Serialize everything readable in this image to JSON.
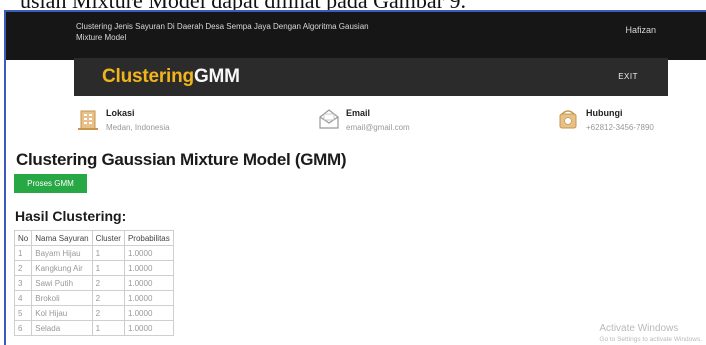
{
  "document": {
    "caption_fragment": "usian Mixture Model dapat dilihat pada Gambar 9."
  },
  "topbar": {
    "site_title": "Clustering Jenis Sayuran Di Daerah Desa Sempa Jaya Dengan Algoritma Gausian Mixture Model",
    "username": "Hafizan"
  },
  "navbar": {
    "brand_part1": "Clustering",
    "brand_part2": "GMM",
    "exit_label": "EXIT"
  },
  "info": {
    "lokasi": {
      "label": "Lokasi",
      "value": "Medan, Indonesia",
      "icon": "building-icon"
    },
    "email": {
      "label": "Email",
      "value": "email@gmail.com",
      "icon": "envelope-icon"
    },
    "hubungi": {
      "label": "Hubungi",
      "value": "+62812-3456-7890",
      "icon": "phone-icon"
    }
  },
  "main": {
    "title": "Clustering Gaussian Mixture Model (GMM)",
    "proses_button": "Proses GMM",
    "hasil_title": "Hasil Clustering:"
  },
  "table": {
    "headers": [
      "No",
      "Nama Sayuran",
      "Cluster",
      "Probabilitas"
    ],
    "rows": [
      [
        "1",
        "Bayam Hijau",
        "1",
        "1.0000"
      ],
      [
        "2",
        "Kangkung Air",
        "1",
        "1.0000"
      ],
      [
        "3",
        "Sawi Putih",
        "2",
        "1.0000"
      ],
      [
        "4",
        "Brokoli",
        "2",
        "1.0000"
      ],
      [
        "5",
        "Kol Hijau",
        "2",
        "1.0000"
      ],
      [
        "6",
        "Selada",
        "1",
        "1.0000"
      ]
    ]
  },
  "watermark": {
    "line1": "Activate Windows",
    "line2": "Go to Settings to activate Windows."
  },
  "colors": {
    "brand_accent": "#f0b41c",
    "button_green": "#28a745",
    "topbar_bg": "#161616",
    "navbar_bg": "#2b2b2b"
  }
}
